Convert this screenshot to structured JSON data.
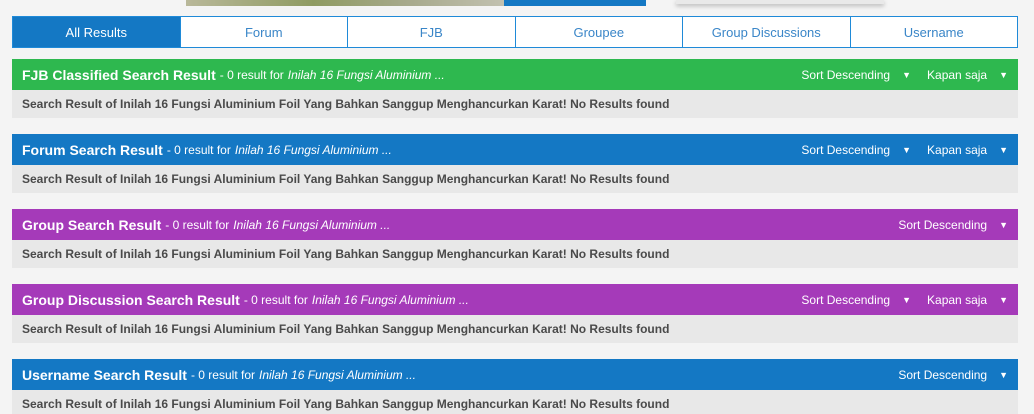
{
  "tabs": [
    "All Results",
    "Forum",
    "FJB",
    "Groupee",
    "Group Discussions",
    "Username"
  ],
  "active_tab": "All Results",
  "sections": [
    {
      "title": "FJB Classified Search Result",
      "count_text": "- 0 result for",
      "query": "Inilah 16 Fungsi Aluminium ...",
      "sort_label": "Sort Descending",
      "time_label": "Kapan saja",
      "body": "Search Result of Inilah 16 Fungsi Aluminium Foil Yang Bahkan Sanggup Menghancurkan Karat! No Results found",
      "color": "#2eb84f"
    },
    {
      "title": "Forum Search Result",
      "count_text": "- 0 result for",
      "query": "Inilah 16 Fungsi Aluminium ...",
      "sort_label": "Sort Descending",
      "time_label": "Kapan saja",
      "body": "Search Result of Inilah 16 Fungsi Aluminium Foil Yang Bahkan Sanggup Menghancurkan Karat! No Results found",
      "color": "#1478c4"
    },
    {
      "title": "Group Search Result",
      "count_text": "- 0 result for",
      "query": "Inilah 16 Fungsi Aluminium ...",
      "sort_label": "Sort Descending",
      "body": "Search Result of Inilah 16 Fungsi Aluminium Foil Yang Bahkan Sanggup Menghancurkan Karat! No Results found",
      "color": "#a53ab9"
    },
    {
      "title": "Group Discussion Search Result",
      "count_text": "- 0 result for",
      "query": "Inilah 16 Fungsi Aluminium ...",
      "sort_label": "Sort Descending",
      "time_label": "Kapan saja",
      "body": "Search Result of Inilah 16 Fungsi Aluminium Foil Yang Bahkan Sanggup Menghancurkan Karat! No Results found",
      "color": "#a53ab9"
    },
    {
      "title": "Username Search Result",
      "count_text": "- 0 result for",
      "query": "Inilah 16 Fungsi Aluminium ...",
      "sort_label": "Sort Descending",
      "body": "Search Result of Inilah 16 Fungsi Aluminium Foil Yang Bahkan Sanggup Menghancurkan Karat! No Results found",
      "color": "#1478c4"
    }
  ],
  "icons": {
    "dropdown": "chevron-down-icon"
  },
  "colors": {
    "accent": "#1478c4",
    "fjb": "#2eb84f",
    "group": "#a53ab9"
  }
}
